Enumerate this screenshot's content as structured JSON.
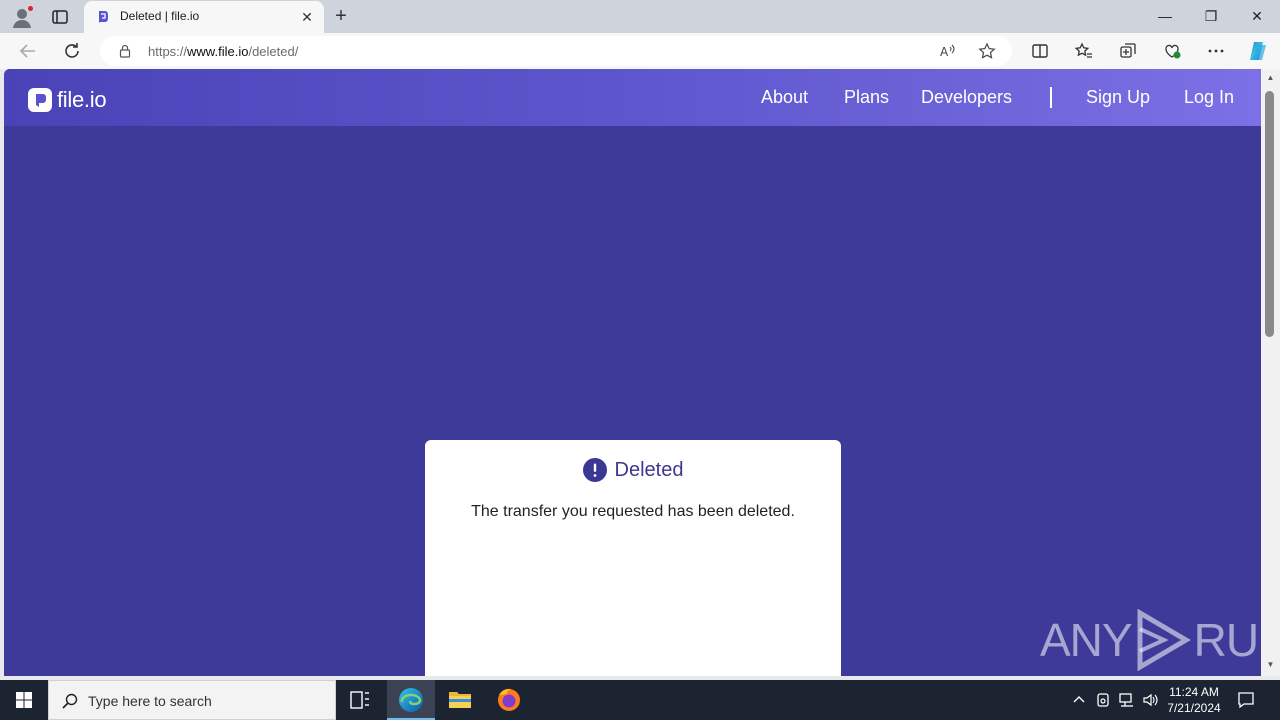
{
  "browser": {
    "tab_title": "Deleted | file.io",
    "url_prefix": "https://",
    "url_domain": "www.file.io",
    "url_path": "/deleted/",
    "close_tab": "✕",
    "new_tab": "+",
    "minimize": "—",
    "restore": "❐",
    "close_window": "✕"
  },
  "site": {
    "logo_text": "file.io",
    "nav": {
      "about": "About",
      "plans": "Plans",
      "developers": "Developers",
      "signup": "Sign Up",
      "login": "Log In"
    },
    "card": {
      "title": "Deleted",
      "message": "The transfer you requested has been deleted."
    },
    "colors": {
      "background": "#3d3a99",
      "accent": "#3b3893",
      "header_end": "#7c70e6"
    }
  },
  "watermark": {
    "left": "ANY",
    "right": "RUN"
  },
  "taskbar": {
    "search_placeholder": "Type here to search",
    "time": "11:24 AM",
    "date": "7/21/2024"
  }
}
